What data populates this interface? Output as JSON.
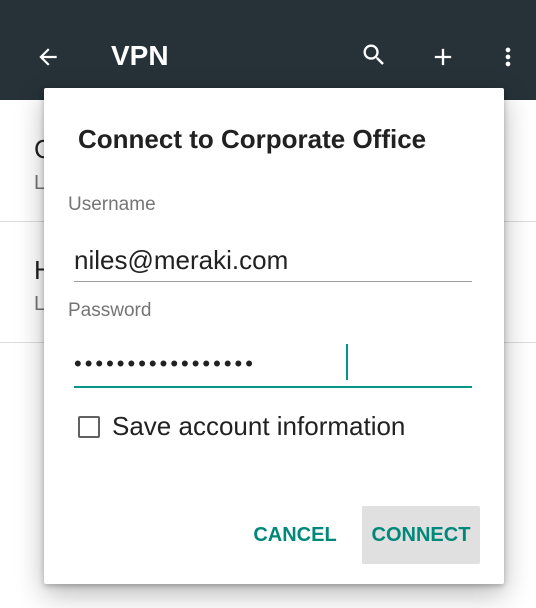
{
  "appbar": {
    "title": "VPN",
    "back_icon": "arrow-back-icon",
    "search_icon": "search-icon",
    "add_icon": "add-icon",
    "more_icon": "more-vert-icon",
    "color": "#263238"
  },
  "list": {
    "items": [
      {
        "name": "C",
        "sub": "L"
      },
      {
        "name": "H",
        "sub": "L"
      }
    ]
  },
  "dialog": {
    "title": "Connect to Corporate Office",
    "username": {
      "label": "Username",
      "value": "niles@meraki.com"
    },
    "password": {
      "label": "Password",
      "value": "•••••••••••••••••",
      "accent": "#009688"
    },
    "save_account": {
      "label": "Save account information",
      "checked": false
    },
    "buttons": {
      "cancel": "CANCEL",
      "connect": "CONNECT"
    },
    "accent": "#00897b"
  }
}
